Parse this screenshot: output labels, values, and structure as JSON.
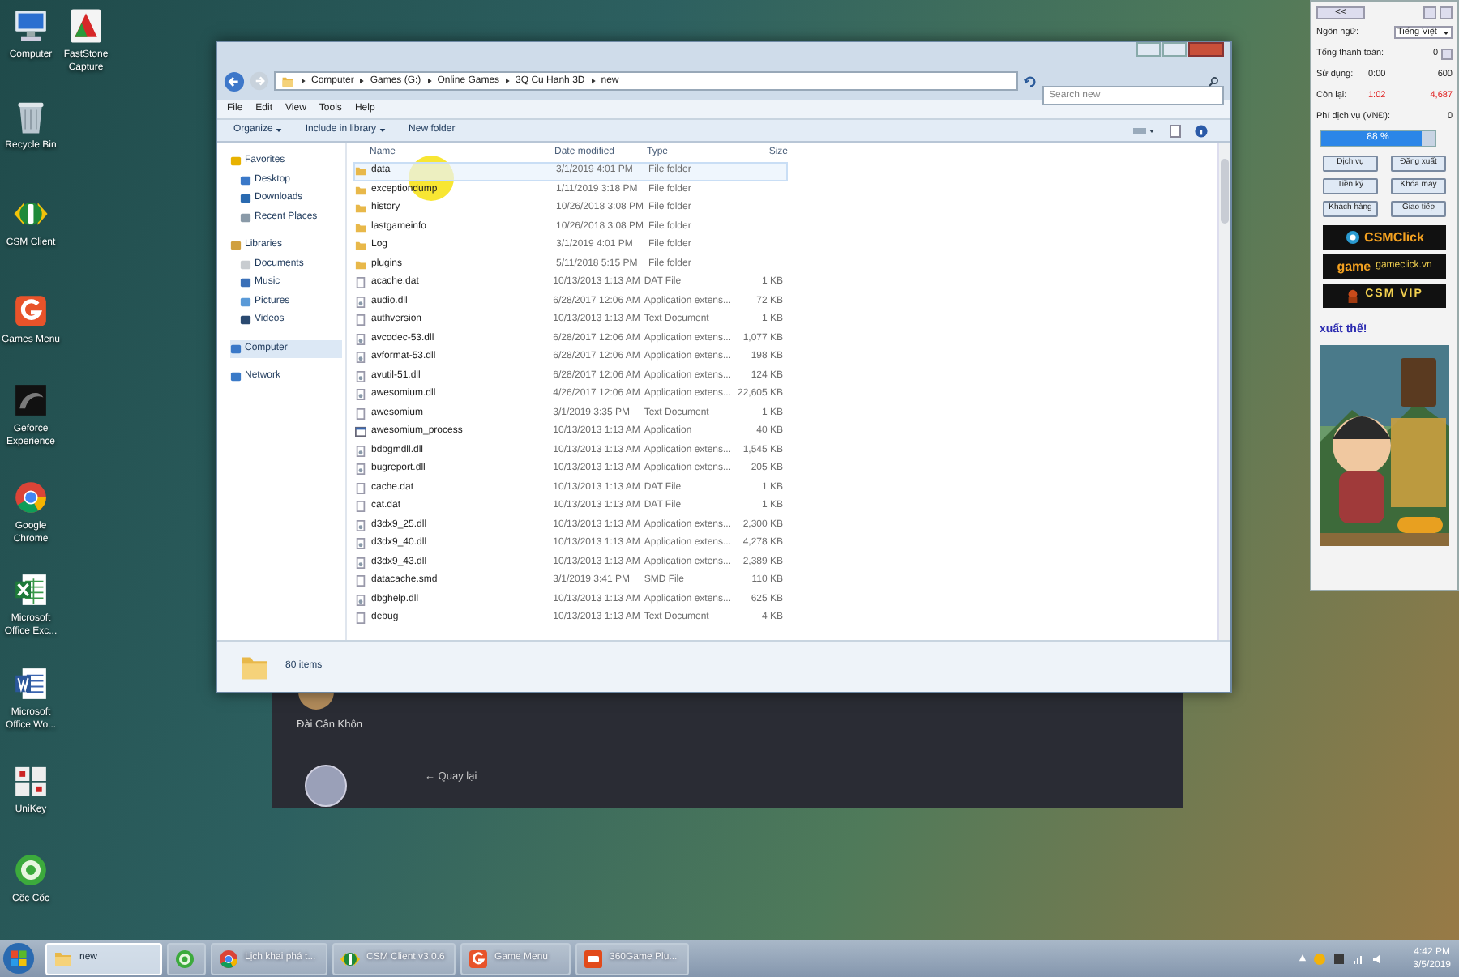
{
  "desktop_icons": [
    {
      "label": "Computer",
      "kind": "computer"
    },
    {
      "label": "FastStone Capture",
      "kind": "capture"
    },
    {
      "label": "Recycle Bin",
      "kind": "recycle"
    },
    {
      "label": "CSM Client",
      "kind": "coin"
    },
    {
      "label": "Games Menu",
      "kind": "games"
    },
    {
      "label": "Geforce Experience",
      "kind": "geforce"
    },
    {
      "label": "Google Chrome",
      "kind": "browser"
    },
    {
      "label": "Microsoft Office Exc...",
      "kind": "sheet"
    },
    {
      "label": "Microsoft Office Wo...",
      "kind": "doc"
    },
    {
      "label": "UniKey",
      "kind": "keys"
    },
    {
      "label": "Cốc Cốc",
      "kind": "coccoc"
    }
  ],
  "back_window": {
    "caption": "Đài Cân Khôn",
    "back_link": "← Quay lại"
  },
  "explorer": {
    "address": [
      "Computer",
      "Games (G:)",
      "Online Games",
      "3Q Cu Hanh 3D",
      "new"
    ],
    "search": {
      "placeholder": "Search new"
    },
    "menu": [
      "File",
      "Edit",
      "View",
      "Tools",
      "Help"
    ],
    "toolbar": [
      {
        "label": "Organize",
        "dropdown": true
      },
      {
        "label": "Include in library",
        "dropdown": true
      },
      {
        "label": "New folder",
        "dropdown": false
      }
    ],
    "nav": [
      {
        "label": "Favorites",
        "kind": "star",
        "header": true,
        "selected": false
      },
      {
        "label": "Desktop",
        "kind": "desktop",
        "header": false,
        "selected": false
      },
      {
        "label": "Downloads",
        "kind": "download",
        "header": false,
        "selected": false
      },
      {
        "label": "Recent Places",
        "kind": "recent",
        "header": false,
        "selected": false
      },
      {
        "label": "Libraries",
        "kind": "library",
        "header": true,
        "selected": false
      },
      {
        "label": "Documents",
        "kind": "doc",
        "header": false,
        "selected": false
      },
      {
        "label": "Music",
        "kind": "music",
        "header": false,
        "selected": false
      },
      {
        "label": "Pictures",
        "kind": "pictures",
        "header": false,
        "selected": false
      },
      {
        "label": "Videos",
        "kind": "videos",
        "header": false,
        "selected": false
      },
      {
        "label": "Computer",
        "kind": "computer",
        "header": true,
        "selected": true
      },
      {
        "label": "Network",
        "kind": "network",
        "header": true,
        "selected": false
      }
    ],
    "columns": [
      "Name",
      "Date modified",
      "Type",
      "Size"
    ],
    "files": [
      {
        "name": "data",
        "date": "3/1/2019 4:01 PM",
        "type": "File folder",
        "kind": "folder",
        "hovered": true
      },
      {
        "name": "exceptiondump",
        "date": "1/11/2019 3:18 PM",
        "type": "File folder",
        "kind": "folder",
        "hovered": false
      },
      {
        "name": "history",
        "date": "10/26/2018 3:08 PM",
        "type": "File folder",
        "kind": "folder",
        "hovered": false
      },
      {
        "name": "lastgameinfo",
        "date": "10/26/2018 3:08 PM",
        "type": "File folder",
        "kind": "folder",
        "hovered": false
      },
      {
        "name": "Log",
        "date": "3/1/2019 4:01 PM",
        "type": "File folder",
        "kind": "folder",
        "hovered": false
      },
      {
        "name": "plugins",
        "date": "5/11/2018 5:15 PM",
        "type": "File folder",
        "kind": "folder",
        "hovered": false
      },
      {
        "name": "acache.dat",
        "date": "10/13/2013 1:13 AM",
        "type": "DAT File",
        "size": "1 KB",
        "kind": "file",
        "hovered": false
      },
      {
        "name": "audio.dll",
        "date": "6/28/2017 12:06 AM",
        "type": "Application extens...",
        "size": "72 KB",
        "kind": "dll",
        "hovered": false
      },
      {
        "name": "authversion",
        "date": "10/13/2013 1:13 AM",
        "type": "Text Document",
        "size": "1 KB",
        "kind": "file",
        "hovered": false
      },
      {
        "name": "avcodec-53.dll",
        "date": "6/28/2017 12:06 AM",
        "type": "Application extens...",
        "size": "1,077 KB",
        "kind": "dll",
        "hovered": false
      },
      {
        "name": "avformat-53.dll",
        "date": "6/28/2017 12:06 AM",
        "type": "Application extens...",
        "size": "198 KB",
        "kind": "dll",
        "hovered": false
      },
      {
        "name": "avutil-51.dll",
        "date": "6/28/2017 12:06 AM",
        "type": "Application extens...",
        "size": "124 KB",
        "kind": "dll",
        "hovered": false
      },
      {
        "name": "awesomium.dll",
        "date": "4/26/2017 12:06 AM",
        "type": "Application extens...",
        "size": "22,605 KB",
        "kind": "dll",
        "hovered": false
      },
      {
        "name": "awesomium",
        "date": "3/1/2019 3:35 PM",
        "type": "Text Document",
        "size": "1 KB",
        "kind": "file",
        "hovered": false
      },
      {
        "name": "awesomium_process",
        "date": "10/13/2013 1:13 AM",
        "type": "Application",
        "size": "40 KB",
        "kind": "app",
        "hovered": false
      },
      {
        "name": "bdbgmdll.dll",
        "date": "10/13/2013 1:13 AM",
        "type": "Application extens...",
        "size": "1,545 KB",
        "kind": "dll",
        "hovered": false
      },
      {
        "name": "bugreport.dll",
        "date": "10/13/2013 1:13 AM",
        "type": "Application extens...",
        "size": "205 KB",
        "kind": "dll",
        "hovered": false
      },
      {
        "name": "cache.dat",
        "date": "10/13/2013 1:13 AM",
        "type": "DAT File",
        "size": "1 KB",
        "kind": "file",
        "hovered": false
      },
      {
        "name": "cat.dat",
        "date": "10/13/2013 1:13 AM",
        "type": "DAT File",
        "size": "1 KB",
        "kind": "file",
        "hovered": false
      },
      {
        "name": "d3dx9_25.dll",
        "date": "10/13/2013 1:13 AM",
        "type": "Application extens...",
        "size": "2,300 KB",
        "kind": "dll",
        "hovered": false
      },
      {
        "name": "d3dx9_40.dll",
        "date": "10/13/2013 1:13 AM",
        "type": "Application extens...",
        "size": "4,278 KB",
        "kind": "dll",
        "hovered": false
      },
      {
        "name": "d3dx9_43.dll",
        "date": "10/13/2013 1:13 AM",
        "type": "Application extens...",
        "size": "2,389 KB",
        "kind": "dll",
        "hovered": false
      },
      {
        "name": "datacache.smd",
        "date": "3/1/2019 3:41 PM",
        "type": "SMD File",
        "size": "110 KB",
        "kind": "file",
        "hovered": false
      },
      {
        "name": "dbghelp.dll",
        "date": "10/13/2013 1:13 AM",
        "type": "Application extens...",
        "size": "625 KB",
        "kind": "dll",
        "hovered": false
      },
      {
        "name": "debug",
        "date": "10/13/2013 1:13 AM",
        "type": "Text Document",
        "size": "4 KB",
        "kind": "file",
        "hovered": false
      }
    ],
    "status": "80 items"
  },
  "csm_panel": {
    "collapse": "<<",
    "language": {
      "label": "Ngôn ngữ:",
      "value": "Tiếng Việt"
    },
    "total": {
      "label": "Tổng thanh toán:",
      "value": "0"
    },
    "used": {
      "label": "Sử dụng:",
      "time": "0:00",
      "amount": "600"
    },
    "remaining": {
      "label": "Còn lại:",
      "time": "1:02",
      "amount": "4,687"
    },
    "fee": {
      "label": "Phí dịch vụ (VNĐ):",
      "value": "0"
    },
    "progress": {
      "level": 0.88,
      "reading": "88 %"
    },
    "buttons": [
      "Dịch vụ",
      "Đăng xuất",
      "Tiền ký",
      "Khóa máy",
      "Khách hàng",
      "Giao tiếp"
    ],
    "banners": [
      {
        "kind": "click",
        "text": "CSMClick"
      },
      {
        "kind": "gameclick",
        "text": "game",
        "site": "gameclick.vn"
      },
      {
        "kind": "vip",
        "text": "CSM VIP"
      }
    ],
    "promo_title": "xuất thế!"
  },
  "taskbar": {
    "items": [
      {
        "label": "new",
        "kind": "folder",
        "selected": true
      },
      {
        "kind": "coccoc",
        "selected": false
      },
      {
        "label": "Lịch khai phá t...",
        "kind": "browser",
        "selected": false
      },
      {
        "label": "CSM Client v3.0.6",
        "kind": "coin",
        "selected": false
      },
      {
        "label": "Game Menu",
        "kind": "games",
        "selected": false
      },
      {
        "label": "360Game Plu...",
        "kind": "game360",
        "selected": false
      }
    ],
    "time": "4:42 PM",
    "date": "3/5/2019"
  }
}
